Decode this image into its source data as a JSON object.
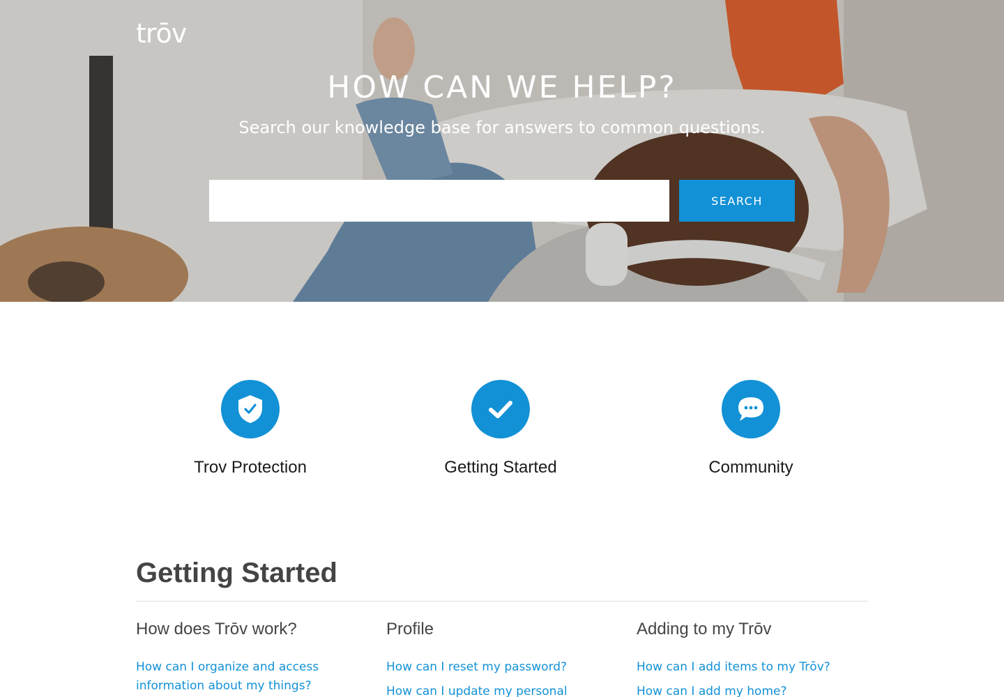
{
  "header": {
    "logo_text": "trōv"
  },
  "hero": {
    "title": "HOW CAN WE HELP?",
    "subtitle": "Search our knowledge base for answers to common questions.",
    "search_placeholder": "",
    "search_button_label": "SEARCH"
  },
  "categories": [
    {
      "label": "Trov Protection",
      "icon": "shield-check-icon"
    },
    {
      "label": "Getting Started",
      "icon": "checkmark-icon"
    },
    {
      "label": "Community",
      "icon": "chat-bubble-icon"
    }
  ],
  "section": {
    "title": "Getting Started",
    "columns": [
      {
        "heading": "How does Trōv work?",
        "links": [
          "How can I organize and access information about my things?"
        ]
      },
      {
        "heading": "Profile",
        "links": [
          "How can I reset my password?",
          "How can I update my personal"
        ]
      },
      {
        "heading": "Adding to my Trōv",
        "links": [
          "How can I add items to my Trōv?",
          "How can I add my home?"
        ]
      }
    ]
  },
  "colors": {
    "accent": "#1291d6",
    "link": "#1291d6",
    "heading": "#444444",
    "divider": "#dcdcdc"
  }
}
